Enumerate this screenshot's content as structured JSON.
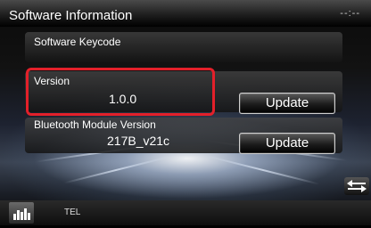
{
  "header": {
    "title": "Software Information",
    "clock": "--:--"
  },
  "sections": {
    "keycode_label": "Software Keycode",
    "version_label": "Version",
    "version_value": "1.0.0",
    "version_update_label": "Update",
    "bt_label": "Bluetooth Module Version",
    "bt_value": "217B_v21c",
    "bt_update_label": "Update"
  },
  "footer": {
    "tel_label": "TEL",
    "eq_icon": "equalizer-icon",
    "back_icon": "return-arrow-icon"
  },
  "colors": {
    "highlight": "#e3202a"
  }
}
